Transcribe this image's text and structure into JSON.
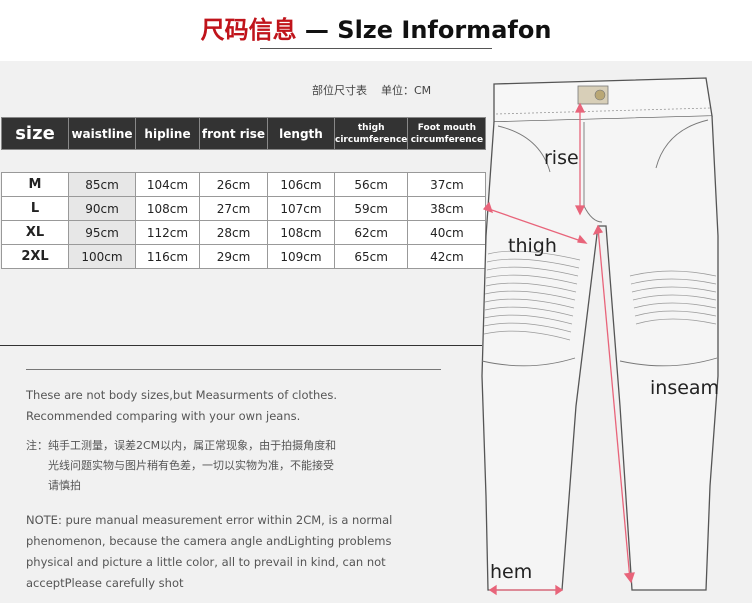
{
  "header": {
    "title_cn": "尺码信息",
    "title_en": " — Slze Informafon"
  },
  "unit_note": "部位尺寸表    单位：CM",
  "size_table": {
    "headers": {
      "size": "size",
      "waistline": "waistline",
      "hipline": "hipline",
      "front_rise": "front rise",
      "length": "length",
      "thigh_line1": "thigh",
      "thigh_line2": "circumference",
      "foot_line1": "Foot mouth",
      "foot_line2": "circumference"
    },
    "rows": [
      {
        "size": "M",
        "waistline": "85cm",
        "hipline": "104cm",
        "front_rise": "26cm",
        "length": "106cm",
        "thigh": "56cm",
        "foot": "37cm"
      },
      {
        "size": "L",
        "waistline": "90cm",
        "hipline": "108cm",
        "front_rise": "27cm",
        "length": "107cm",
        "thigh": "59cm",
        "foot": "38cm"
      },
      {
        "size": "XL",
        "waistline": "95cm",
        "hipline": "112cm",
        "front_rise": "28cm",
        "length": "108cm",
        "thigh": "62cm",
        "foot": "40cm"
      },
      {
        "size": "2XL",
        "waistline": "100cm",
        "hipline": "116cm",
        "front_rise": "29cm",
        "length": "109cm",
        "thigh": "65cm",
        "foot": "42cm"
      }
    ]
  },
  "notes": {
    "en_line1": "These are not body sizes,but Measurments of clothes.",
    "en_line2": "Recommended comparing with your own jeans.",
    "cn_line1": "注：纯手工测量，误差2CM以内，属正常现象，由于拍摄角度和",
    "cn_line2": "光线问题实物与图片稍有色差，一切以实物为准，不能接受",
    "cn_line3": "请慎拍",
    "en2_line1": "NOTE: pure manual measurement error within 2CM, is a normal",
    "en2_line2": "phenomenon, because the camera angle andLighting problems",
    "en2_line3": "physical and picture a little color, all to prevail in kind, can not",
    "en2_line4": "acceptPlease carefully shot"
  },
  "diagram": {
    "label_rise": "rise",
    "label_thigh": "thigh",
    "label_inseam": "inseam",
    "label_hem": "hem",
    "measure_color": "#e8647a"
  }
}
